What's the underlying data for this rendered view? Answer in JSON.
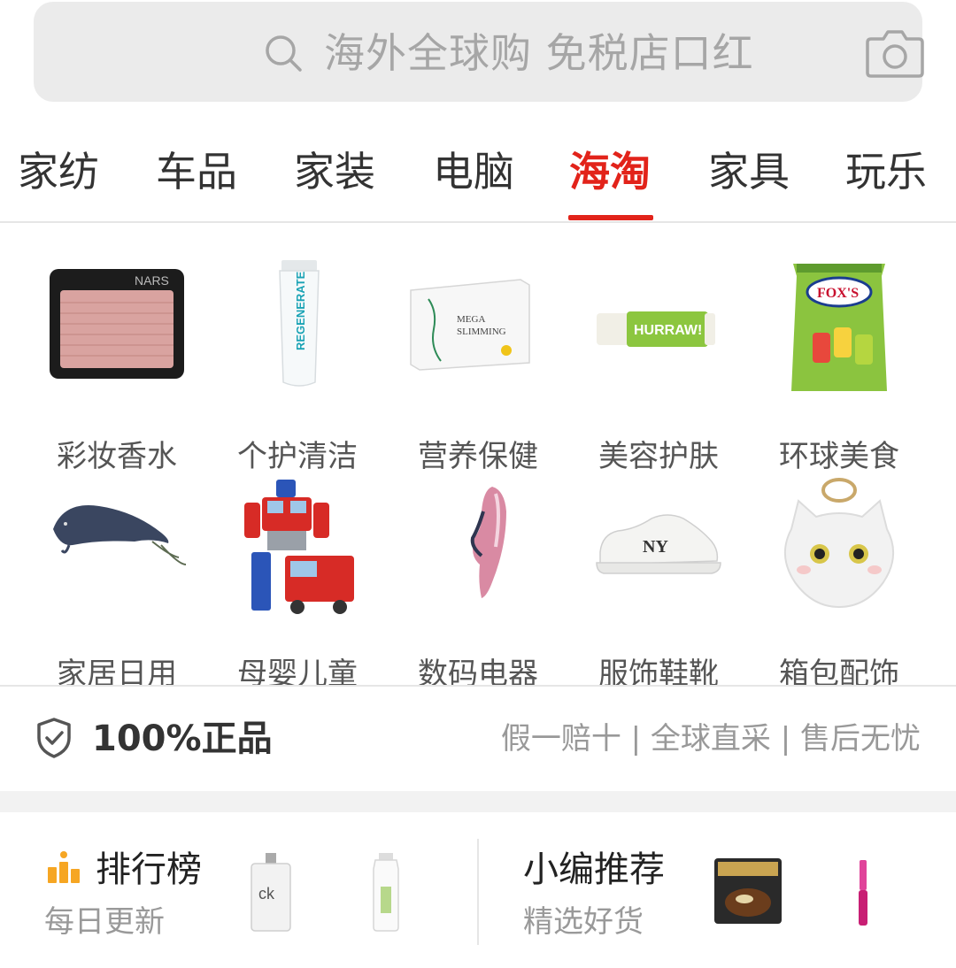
{
  "search": {
    "placeholder": "海外全球购 免税店口红",
    "search_icon": "search-icon",
    "camera_icon": "camera-icon"
  },
  "tabs": [
    {
      "label": "家纺",
      "active": false
    },
    {
      "label": "车品",
      "active": false
    },
    {
      "label": "家装",
      "active": false
    },
    {
      "label": "电脑",
      "active": false
    },
    {
      "label": "海淘",
      "active": true
    },
    {
      "label": "家具",
      "active": false
    },
    {
      "label": "玩乐",
      "active": false
    }
  ],
  "categories": [
    {
      "label": "彩妆香水",
      "image": "blush-compact"
    },
    {
      "label": "个护清洁",
      "image": "cream-tube"
    },
    {
      "label": "营养保健",
      "image": "slimming-box"
    },
    {
      "label": "美容护肤",
      "image": "lip-balm"
    },
    {
      "label": "环球美食",
      "image": "candy-bag"
    },
    {
      "label": "家居日用",
      "image": "fish"
    },
    {
      "label": "母婴儿童",
      "image": "robot-toy"
    },
    {
      "label": "数码电器",
      "image": "gadget"
    },
    {
      "label": "服饰鞋靴",
      "image": "sneaker"
    },
    {
      "label": "箱包配饰",
      "image": "plush-keychain"
    }
  ],
  "guarantee": {
    "title": "100%正品",
    "tagline": "假一赔十 | 全球直采 | 售后无忧",
    "icon": "shield-check-icon"
  },
  "cards": {
    "ranking": {
      "title": "排行榜",
      "subtitle": "每日更新",
      "icon": "ranking-bars-icon",
      "products": [
        "ck-perfume",
        "lotion-bottle"
      ]
    },
    "editor": {
      "title": "小编推荐",
      "subtitle": "精选好货",
      "products": [
        "noodle-pack",
        "mascara"
      ]
    }
  },
  "colors": {
    "accent": "#e2231a",
    "search_bg": "#ebebeb",
    "muted_text": "#999999",
    "rank_icon": "#f6a623"
  }
}
